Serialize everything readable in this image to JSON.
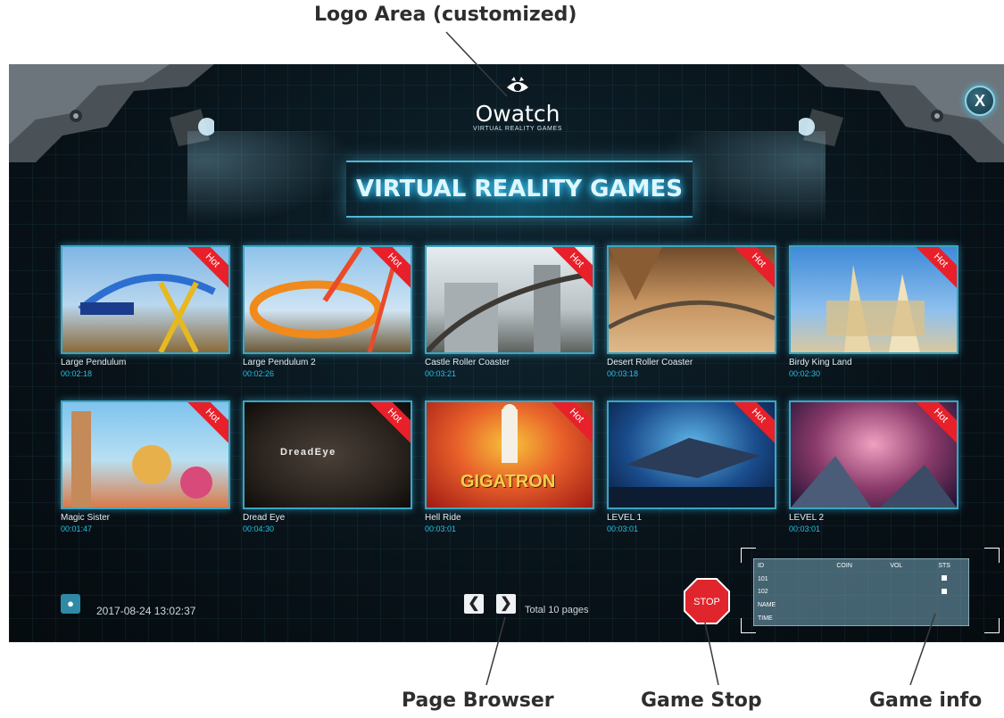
{
  "annotations": {
    "logo_area": "Logo Area (customized)",
    "page_browser": "Page Browser",
    "game_stop": "Game Stop",
    "game_info": "Game info"
  },
  "header": {
    "logo_name": "Owatch",
    "logo_subtitle": "VIRTUAL REALITY GAMES",
    "banner_title": "VIRTUAL REALITY GAMES",
    "close_label": "X"
  },
  "games": [
    {
      "title": "Large Pendulum",
      "duration": "00:02:18",
      "badge": "Hot"
    },
    {
      "title": "Large Pendulum 2",
      "duration": "00:02:26",
      "badge": "Hot"
    },
    {
      "title": "Castle Roller Coaster",
      "duration": "00:03:21",
      "badge": "Hot"
    },
    {
      "title": "Desert Roller Coaster",
      "duration": "00:03:18",
      "badge": "Hot"
    },
    {
      "title": "Birdy King Land",
      "duration": "00:02:30",
      "badge": "Hot"
    },
    {
      "title": "Magic Sister",
      "duration": "00:01:47",
      "badge": "Hot"
    },
    {
      "title": "Dread Eye",
      "duration": "00:04:30",
      "badge": "Hot"
    },
    {
      "title": "Hell Ride",
      "duration": "00:03:01",
      "badge": "Hot"
    },
    {
      "title": "LEVEL 1",
      "duration": "00:03:01",
      "badge": "Hot"
    },
    {
      "title": "LEVEL 2",
      "duration": "00:03:01",
      "badge": "Hot"
    }
  ],
  "thumb_text": {
    "dread_eye": "DreadEye",
    "gigatron": "GIGATRON"
  },
  "footer": {
    "datetime": "2017-08-24  13:02:37",
    "total_pages": "Total 10 pages",
    "stop_label": "STOP",
    "prev_icon": "chevron-left-icon",
    "next_icon": "chevron-right-icon"
  },
  "info_table": {
    "headers": [
      "ID",
      "COIN",
      "VOL",
      "STS"
    ],
    "rows": [
      "101",
      "102"
    ],
    "name_label": "NAME",
    "time_label": "TIME"
  },
  "colors": {
    "accent": "#25c0e8",
    "hot_badge": "#e8202a",
    "stop": "#e0252c"
  }
}
